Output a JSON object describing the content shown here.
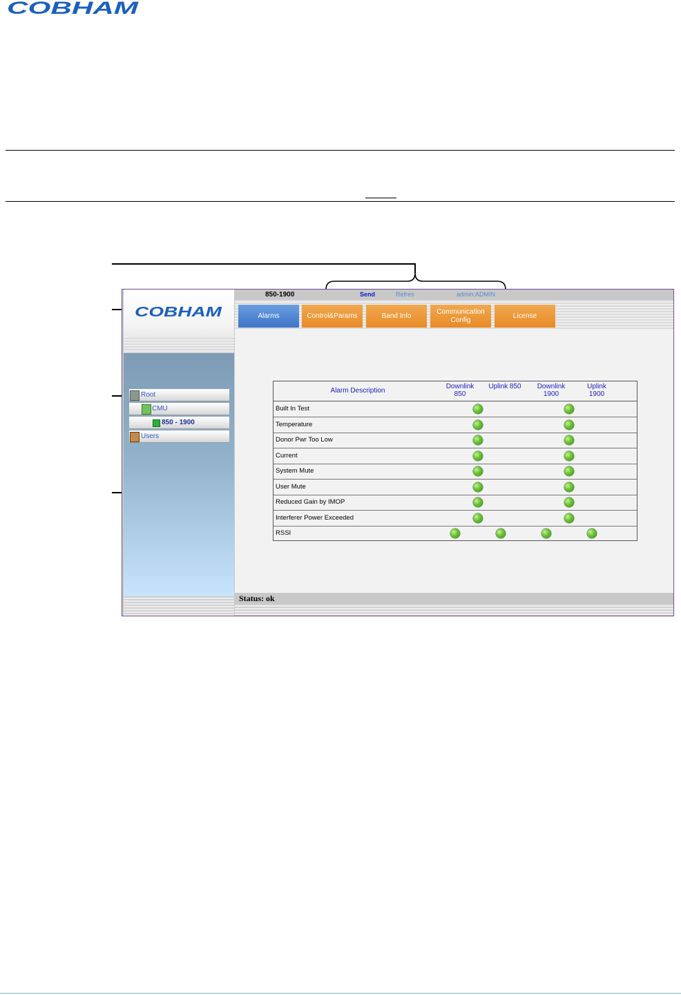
{
  "document": {
    "brand_logo": "COBHAM"
  },
  "app": {
    "logo": "COBHAM",
    "top_bar": {
      "device_name": "850-1900",
      "send": "Send",
      "refresh": "Refres",
      "user": "admin:ADMIN"
    },
    "tabs": [
      {
        "label": "Alarms",
        "active": true
      },
      {
        "label": "Control&Params",
        "active": false
      },
      {
        "label": "Band Info",
        "active": false
      },
      {
        "label": "Communication Config",
        "active": false
      },
      {
        "label": "License",
        "active": false
      }
    ],
    "tree": [
      {
        "label": "Root",
        "icon": "root-icon"
      },
      {
        "label": "CMU",
        "icon": "cmu-icon"
      },
      {
        "label": "850 - 1900",
        "icon": "band-status-icon"
      },
      {
        "label": "Users",
        "icon": "users-icon"
      }
    ],
    "alarm_table": {
      "headers": {
        "description": "Alarm Description",
        "dl850": "Downlink 850",
        "ul850": "Uplink 850",
        "dl1900": "Downlink 1900",
        "ul1900": "Uplink 1900"
      },
      "rows": [
        {
          "label": "Built In Test",
          "indicators": [
            "ok",
            "",
            "ok",
            ""
          ]
        },
        {
          "label": "Temperature",
          "indicators": [
            "ok",
            "",
            "ok",
            ""
          ]
        },
        {
          "label": "Donor Pwr Too Low",
          "indicators": [
            "ok",
            "",
            "ok",
            ""
          ]
        },
        {
          "label": "Current",
          "indicators": [
            "ok",
            "",
            "ok",
            ""
          ]
        },
        {
          "label": "System Mute",
          "indicators": [
            "ok",
            "",
            "ok",
            ""
          ]
        },
        {
          "label": "User Mute",
          "indicators": [
            "ok",
            "",
            "ok",
            ""
          ]
        },
        {
          "label": "Reduced Gain by IMOP",
          "indicators": [
            "ok",
            "",
            "ok",
            ""
          ]
        },
        {
          "label": "Interferer Power Exceeded",
          "indicators": [
            "ok",
            "",
            "ok",
            ""
          ]
        },
        {
          "label": "RSSI",
          "indicators": [
            "ok",
            "ok",
            "ok",
            "ok"
          ]
        }
      ]
    },
    "status": "Status: ok",
    "colors": {
      "brand_blue": "#1b5fbf",
      "tab_orange": "#e98a26",
      "tab_active_blue": "#3e74c6",
      "led_green": "#6fc43a"
    }
  }
}
